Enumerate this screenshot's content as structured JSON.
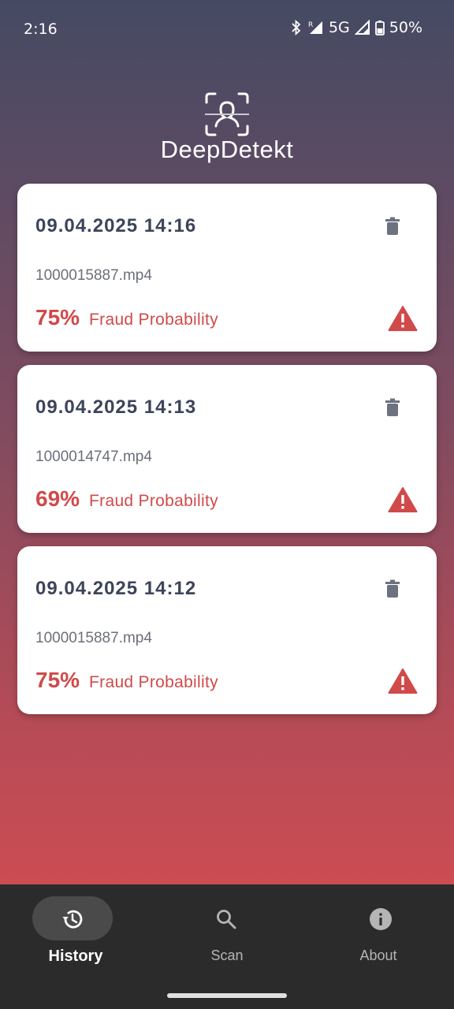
{
  "status_bar": {
    "time": "2:16",
    "network": "5G",
    "battery": "50%"
  },
  "app": {
    "title": "DeepDetekt"
  },
  "history": [
    {
      "date": "09.04.2025 14:16",
      "file": "1000015887.mp4",
      "probability": "75%",
      "label": "Fraud Probability"
    },
    {
      "date": "09.04.2025 14:13",
      "file": "1000014747.mp4",
      "probability": "69%",
      "label": "Fraud Probability"
    },
    {
      "date": "09.04.2025 14:12",
      "file": "1000015887.mp4",
      "probability": "75%",
      "label": "Fraud Probability"
    }
  ],
  "nav": {
    "items": [
      {
        "label": "History",
        "icon": "history-icon",
        "active": true
      },
      {
        "label": "Scan",
        "icon": "search-icon",
        "active": false
      },
      {
        "label": "About",
        "icon": "info-icon",
        "active": false
      }
    ]
  },
  "colors": {
    "accent": "#d04a4a",
    "date_text": "#3d4459",
    "nav_bg": "#2b2b2b"
  }
}
